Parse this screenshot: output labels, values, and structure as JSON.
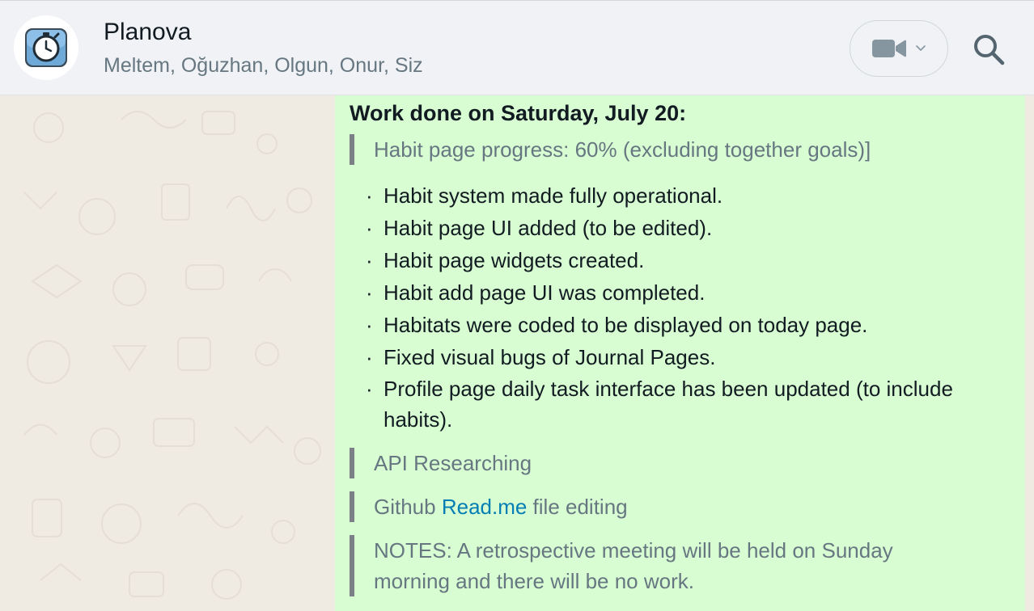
{
  "header": {
    "title": "Planova",
    "members": "Meltem, Oğuzhan, Olgun, Onur, Siz",
    "avatar_icon": "stopwatch-icon",
    "video_icon": "video-camera-icon",
    "dropdown_icon": "chevron-down-icon",
    "search_icon": "search-icon"
  },
  "message": {
    "heading": "Work done on Saturday, July 20:",
    "quote_progress": "Habit page progress: 60% (excluding together goals)]",
    "bullet_char": "·",
    "items": [
      "Habit system made fully operational.",
      "Habit page UI added (to be edited).",
      "Habit page widgets created.",
      "Habit add page UI was completed.",
      "Habitats were coded to be displayed on today page.",
      "Fixed visual bugs of Journal Pages.",
      "Profile page daily task interface has been updated (to include habits)."
    ],
    "quote_api": "API Researching",
    "github_prefix": "Github ",
    "github_link": "Read.me",
    "github_suffix": " file editing",
    "quote_notes": "NOTES: A retrospective meeting will be held on Sunday morning and there will be no work."
  },
  "colors": {
    "header_bg": "#f0f2f5",
    "bubble_bg": "#d9fdd3",
    "chat_bg": "#efeae2",
    "link": "#027eb5",
    "secondary_text": "#667781",
    "quote_bar": "#7a8085"
  }
}
